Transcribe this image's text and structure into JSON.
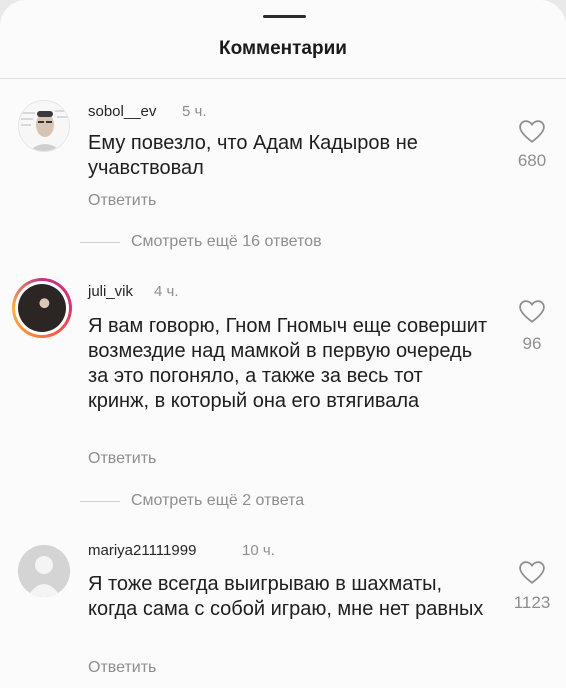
{
  "header": {
    "title": "Комментарии"
  },
  "comments": [
    {
      "username": "sobol__ev",
      "time": "5 ч.",
      "text": "Ему повезло, что Адам Кадыров не учавствовал",
      "reply_label": "Ответить",
      "likes": "680",
      "view_replies": "Смотреть ещё 16 ответов"
    },
    {
      "username": "juli_vik",
      "time": "4 ч.",
      "text": "Я вам говорю, Гном Гномыч еще совершит возмездие над мамкой в первую очередь за это погоняло, а также за весь тот кринж, в который она его втягивала",
      "reply_label": "Ответить",
      "likes": "96",
      "view_replies": "Смотреть ещё 2 ответа"
    },
    {
      "username": "mariya21111999",
      "time": "10 ч.",
      "text": "Я тоже всегда выигрываю в шахматы, когда сама с собой играю, мне нет равных",
      "reply_label": "Ответить",
      "likes": "1123"
    }
  ],
  "icons": {
    "like": "heart-outline-icon",
    "default_avatar": "user-silhouette-icon"
  },
  "colors": {
    "story_ring": "#e1306c",
    "secondary_text": "#8e8e8e"
  }
}
